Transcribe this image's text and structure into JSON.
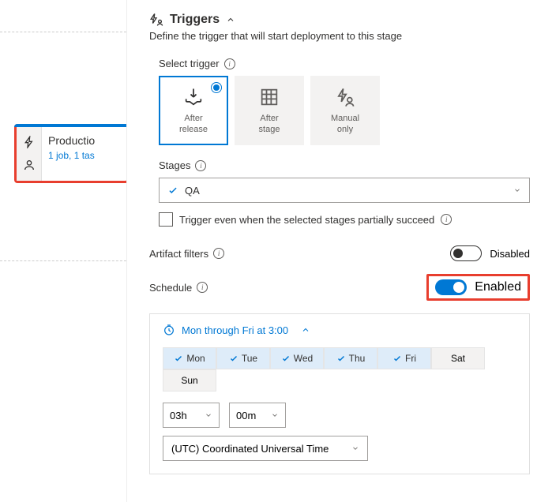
{
  "pipeline": {
    "stage_name": "Productio",
    "stage_meta": "1 job, 1 tas"
  },
  "panel": {
    "title": "Triggers",
    "description": "Define the trigger that will start deployment to this stage"
  },
  "trigger": {
    "label": "Select trigger",
    "tiles": [
      {
        "label1": "After",
        "label2": "release"
      },
      {
        "label1": "After",
        "label2": "stage"
      },
      {
        "label1": "Manual",
        "label2": "only"
      }
    ]
  },
  "stages": {
    "label": "Stages",
    "value": "QA",
    "checkbox_label": "Trigger even when the selected stages partially succeed"
  },
  "artifact": {
    "label": "Artifact filters",
    "state": "Disabled"
  },
  "schedule": {
    "label": "Schedule",
    "state": "Enabled",
    "summary": "Mon through Fri at 3:00",
    "days": [
      "Mon",
      "Tue",
      "Wed",
      "Thu",
      "Fri",
      "Sat",
      "Sun"
    ],
    "selected_days": [
      "Mon",
      "Tue",
      "Wed",
      "Thu",
      "Fri"
    ],
    "hour": "03h",
    "minute": "00m",
    "timezone": "(UTC) Coordinated Universal Time"
  }
}
